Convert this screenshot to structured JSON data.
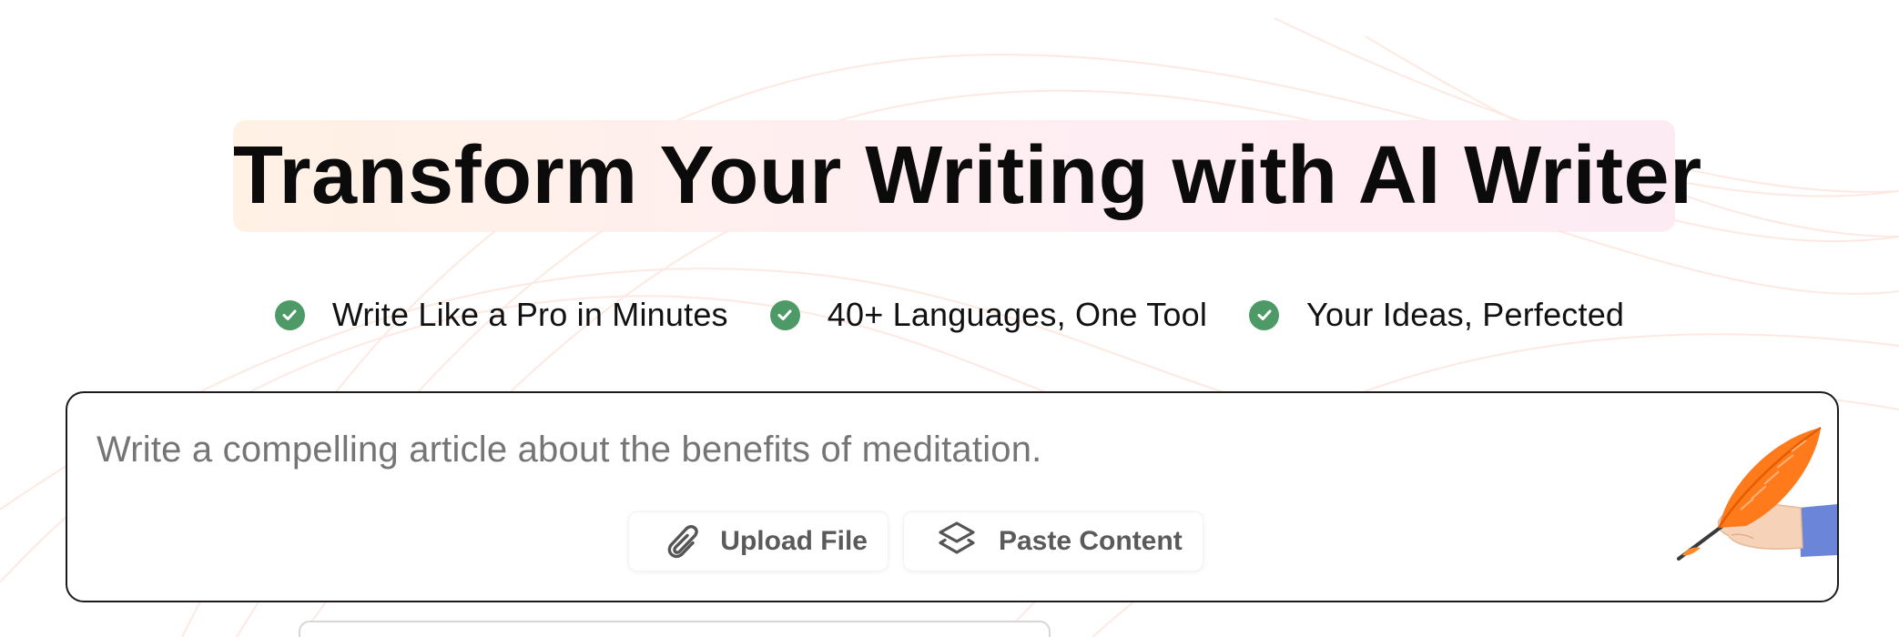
{
  "hero": {
    "title": "Transform Your Writing with AI Writer"
  },
  "features": [
    {
      "icon": "check-circle-icon",
      "label": "Write Like a Pro in Minutes"
    },
    {
      "icon": "check-circle-icon",
      "label": "40+ Languages, One Tool"
    },
    {
      "icon": "check-circle-icon",
      "label": "Your Ideas, Perfected"
    }
  ],
  "prompt": {
    "placeholder": "Write a compelling article about the benefits of meditation.",
    "value": ""
  },
  "actions": {
    "upload_label": "Upload File",
    "upload_icon": "paperclip-icon",
    "paste_label": "Paste Content",
    "paste_icon": "layers-icon"
  },
  "illustration": {
    "icon": "quill-hand-icon"
  },
  "colors": {
    "check": "#4d9a67",
    "title_highlight_start": "#fff1e4",
    "title_highlight_end": "#fdebf3",
    "placeholder_text": "#707070",
    "quill_orange": "#ff7a1a",
    "sleeve_blue": "#6b86d8"
  }
}
